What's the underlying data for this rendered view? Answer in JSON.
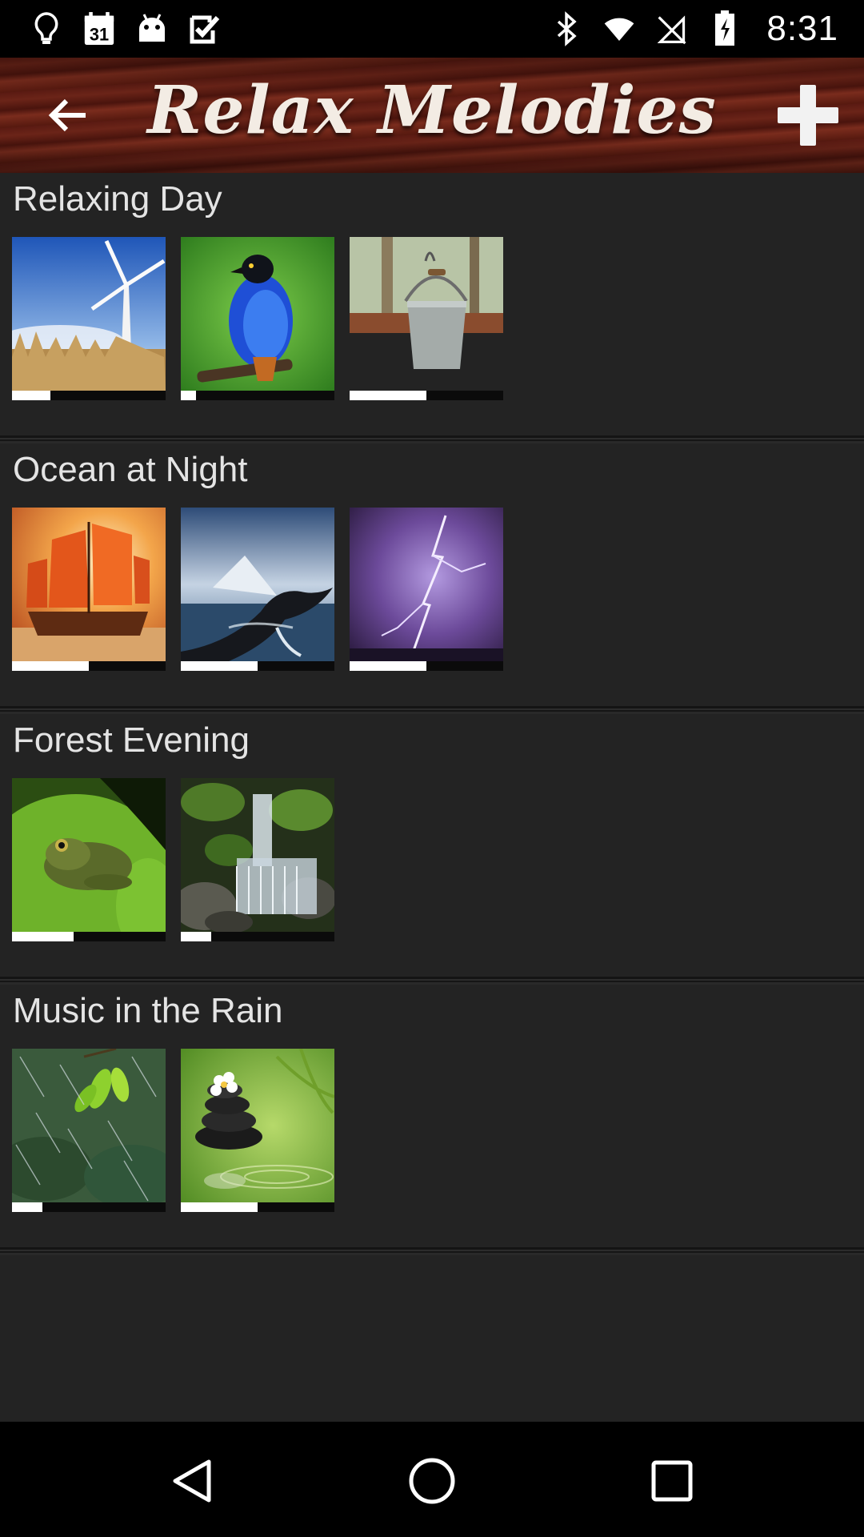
{
  "status_bar": {
    "time": "8:31",
    "left_icons": [
      "lightbulb-icon",
      "calendar-icon",
      "android-icon",
      "task-check-icon"
    ],
    "calendar_day": "31",
    "right_icons": [
      "bluetooth-icon",
      "wifi-icon",
      "no-signal-icon",
      "battery-icon"
    ]
  },
  "app_bar": {
    "title": "Relax Melodies",
    "back_icon": "arrow-back-icon",
    "add_icon": "plus-icon"
  },
  "sections": [
    {
      "title": "Relaxing Day",
      "tracks": [
        {
          "image": "wind-turbine-wheat",
          "progress": 0.25
        },
        {
          "image": "blue-bird",
          "progress": 0.1
        },
        {
          "image": "water-bucket-well",
          "progress": 0.5
        }
      ]
    },
    {
      "title": "Ocean at Night",
      "tracks": [
        {
          "image": "sailing-junk-ship",
          "progress": 0.5
        },
        {
          "image": "whale-tail",
          "progress": 0.5
        },
        {
          "image": "purple-lightning",
          "progress": 0.5
        }
      ]
    },
    {
      "title": "Forest Evening",
      "tracks": [
        {
          "image": "frog-lily-pad",
          "progress": 0.4
        },
        {
          "image": "forest-waterfall",
          "progress": 0.2
        }
      ]
    },
    {
      "title": "Music in the Rain",
      "tracks": [
        {
          "image": "rain-leaves",
          "progress": 0.2
        },
        {
          "image": "zen-stones",
          "progress": 0.5
        }
      ]
    }
  ],
  "nav_bar": {
    "icons": [
      "nav-back-icon",
      "nav-home-icon",
      "nav-recents-icon"
    ]
  },
  "colors": {
    "background": "#232323",
    "status_bar": "#000000",
    "app_bar_wood": "#5b1d13",
    "progress_fill": "#ffffff",
    "progress_track": "#0b0b0b"
  }
}
